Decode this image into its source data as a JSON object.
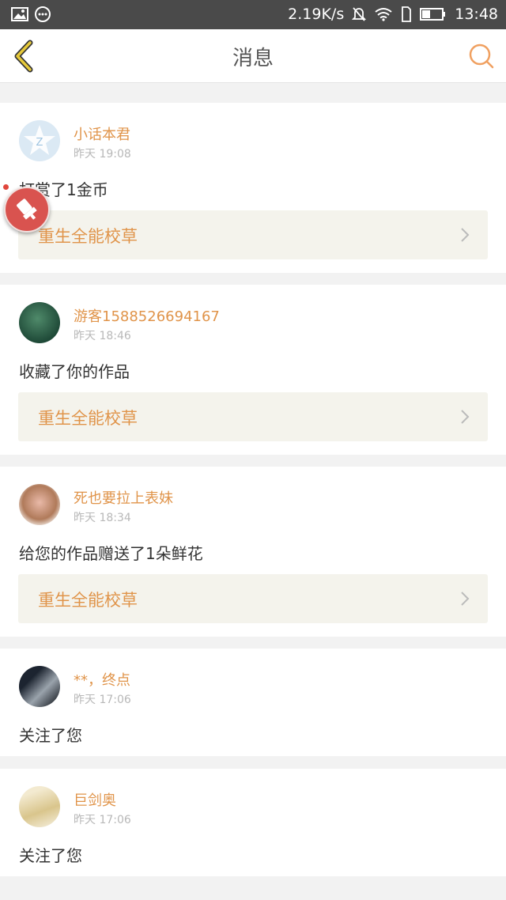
{
  "status_bar": {
    "network_speed": "2.19K/s",
    "time": "13:48",
    "icons": [
      "image-icon",
      "more-icon",
      "mute-icon",
      "wifi-icon",
      "sim-icon",
      "battery-icon"
    ]
  },
  "header": {
    "title": "消息",
    "back_icon": "chevron-left-icon",
    "search_icon": "search-icon",
    "accent_color": "#e6c93a",
    "search_color": "#f0a060"
  },
  "messages": [
    {
      "user": "小话本君",
      "time": "昨天 19:08",
      "action": "打赏了1金币",
      "work": "重生全能校草"
    },
    {
      "user": "游客1588526694167",
      "time": "昨天 18:46",
      "action": "收藏了你的作品",
      "work": "重生全能校草"
    },
    {
      "user": "死也要拉上表妹",
      "time": "昨天 18:34",
      "action": "给您的作品赠送了1朵鲜花",
      "work": "重生全能校草"
    },
    {
      "user": "**，终点",
      "time": "昨天 17:06",
      "action": "关注了您",
      "work": ""
    },
    {
      "user": "巨剑奥",
      "time": "昨天 17:06",
      "action": "关注了您",
      "work": ""
    }
  ],
  "colors": {
    "username": "#e0944a",
    "work_title": "#e0944a",
    "work_bg": "#f4f3ec",
    "floating_button": "#d9534f"
  }
}
